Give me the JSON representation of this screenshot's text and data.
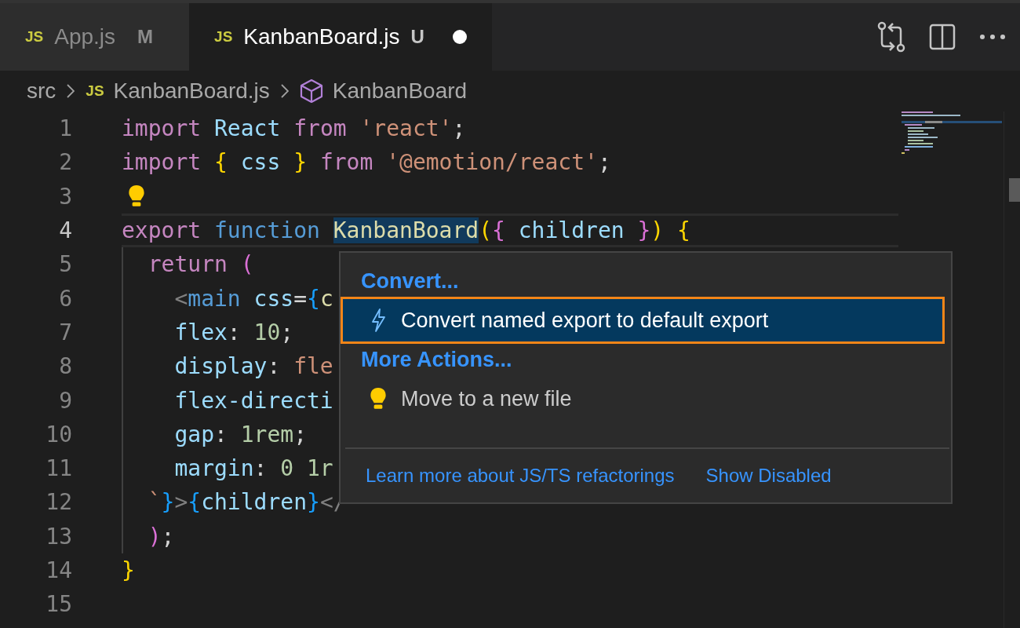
{
  "tabs": [
    {
      "icon": "JS",
      "label": "App.js",
      "status": "M",
      "selected": false,
      "dirty": false
    },
    {
      "icon": "JS",
      "label": "KanbanBoard.js",
      "status": "U",
      "selected": true,
      "dirty": true
    }
  ],
  "breadcrumb": [
    {
      "kind": "folder",
      "text": "src"
    },
    {
      "kind": "file",
      "icon": "JS",
      "text": "KanbanBoard.js"
    },
    {
      "kind": "symbol",
      "text": "KanbanBoard"
    }
  ],
  "code_lines": [
    {
      "number": "1",
      "current": false,
      "kind": "code",
      "tokens": [
        {
          "text": "import ",
          "kind": "keyword",
          "highlighted": false
        },
        {
          "text": "React ",
          "kind": "ident",
          "highlighted": false
        },
        {
          "text": "from ",
          "kind": "keyword",
          "highlighted": false
        },
        {
          "text": "'react'",
          "kind": "string",
          "highlighted": false
        },
        {
          "text": ";",
          "kind": "plain",
          "highlighted": false
        }
      ]
    },
    {
      "number": "2",
      "current": false,
      "kind": "code",
      "tokens": [
        {
          "text": "import ",
          "kind": "keyword",
          "highlighted": false
        },
        {
          "text": "{",
          "kind": "brace1",
          "highlighted": false
        },
        {
          "text": " css ",
          "kind": "ident",
          "highlighted": false
        },
        {
          "text": "} ",
          "kind": "brace1",
          "highlighted": false
        },
        {
          "text": "from ",
          "kind": "keyword",
          "highlighted": false
        },
        {
          "text": "'@emotion/react'",
          "kind": "string",
          "highlighted": false
        },
        {
          "text": ";",
          "kind": "plain",
          "highlighted": false
        }
      ]
    },
    {
      "number": "3",
      "current": false,
      "kind": "lightbulb"
    },
    {
      "number": "4",
      "current": true,
      "kind": "code",
      "tokens": [
        {
          "text": "export ",
          "kind": "keyword",
          "highlighted": false
        },
        {
          "text": "function ",
          "kind": "storage",
          "highlighted": false
        },
        {
          "text": "KanbanBoard",
          "kind": "function",
          "highlighted": true
        },
        {
          "text": "(",
          "kind": "brace1",
          "highlighted": false
        },
        {
          "text": "{",
          "kind": "brace2",
          "highlighted": false
        },
        {
          "text": " children ",
          "kind": "ident",
          "highlighted": false
        },
        {
          "text": "}",
          "kind": "brace2",
          "highlighted": false
        },
        {
          "text": ") ",
          "kind": "brace1",
          "highlighted": false
        },
        {
          "text": "{",
          "kind": "brace1",
          "highlighted": false
        }
      ]
    },
    {
      "number": "5",
      "current": false,
      "kind": "code",
      "tokens": [
        {
          "text": "  return ",
          "kind": "keyword",
          "highlighted": false
        },
        {
          "text": "(",
          "kind": "brace2",
          "highlighted": false
        }
      ]
    },
    {
      "number": "6",
      "current": false,
      "kind": "code",
      "tokens": [
        {
          "text": "    <",
          "kind": "punct",
          "highlighted": false
        },
        {
          "text": "main",
          "kind": "tag",
          "highlighted": false
        },
        {
          "text": " css",
          "kind": "ident",
          "highlighted": false
        },
        {
          "text": "=",
          "kind": "plain",
          "highlighted": false
        },
        {
          "text": "{",
          "kind": "brace3",
          "highlighted": false
        },
        {
          "text": "c",
          "kind": "function",
          "highlighted": false
        }
      ]
    },
    {
      "number": "7",
      "current": false,
      "kind": "code",
      "tokens": [
        {
          "text": "    flex",
          "kind": "ident",
          "highlighted": false
        },
        {
          "text": ": ",
          "kind": "plain",
          "highlighted": false
        },
        {
          "text": "10",
          "kind": "number",
          "highlighted": false
        },
        {
          "text": ";",
          "kind": "plain",
          "highlighted": false
        }
      ]
    },
    {
      "number": "8",
      "current": false,
      "kind": "code",
      "tokens": [
        {
          "text": "    display",
          "kind": "ident",
          "highlighted": false
        },
        {
          "text": ": ",
          "kind": "plain",
          "highlighted": false
        },
        {
          "text": "fle",
          "kind": "string",
          "highlighted": false
        }
      ]
    },
    {
      "number": "9",
      "current": false,
      "kind": "code",
      "tokens": [
        {
          "text": "    flex-directi",
          "kind": "ident",
          "highlighted": false
        }
      ]
    },
    {
      "number": "10",
      "current": false,
      "kind": "code",
      "tokens": [
        {
          "text": "    gap",
          "kind": "ident",
          "highlighted": false
        },
        {
          "text": ": ",
          "kind": "plain",
          "highlighted": false
        },
        {
          "text": "1rem",
          "kind": "number",
          "highlighted": false
        },
        {
          "text": ";",
          "kind": "plain",
          "highlighted": false
        }
      ]
    },
    {
      "number": "11",
      "current": false,
      "kind": "code",
      "tokens": [
        {
          "text": "    margin",
          "kind": "ident",
          "highlighted": false
        },
        {
          "text": ": ",
          "kind": "plain",
          "highlighted": false
        },
        {
          "text": "0 1r",
          "kind": "number",
          "highlighted": false
        }
      ]
    },
    {
      "number": "12",
      "current": false,
      "kind": "code",
      "tokens": [
        {
          "text": "  `",
          "kind": "string",
          "highlighted": false
        },
        {
          "text": "}",
          "kind": "brace3",
          "highlighted": false
        },
        {
          "text": ">",
          "kind": "punct",
          "highlighted": false
        },
        {
          "text": "{",
          "kind": "brace3",
          "highlighted": false
        },
        {
          "text": "children",
          "kind": "ident",
          "highlighted": false
        },
        {
          "text": "}",
          "kind": "brace3",
          "highlighted": false
        },
        {
          "text": "</",
          "kind": "punct",
          "highlighted": false
        }
      ]
    },
    {
      "number": "13",
      "current": false,
      "kind": "code",
      "tokens": [
        {
          "text": "  )",
          "kind": "brace2",
          "highlighted": false
        },
        {
          "text": ";",
          "kind": "plain",
          "highlighted": false
        }
      ]
    },
    {
      "number": "14",
      "current": false,
      "kind": "code",
      "tokens": [
        {
          "text": "}",
          "kind": "brace1",
          "highlighted": false
        }
      ]
    },
    {
      "number": "15",
      "current": false,
      "kind": "code"
    }
  ],
  "code_actions": {
    "sections": [
      {
        "title": "Convert...",
        "items": [
          {
            "kind": "refactor",
            "label": "Convert named export to default export",
            "selected": true
          }
        ]
      },
      {
        "title": "More Actions...",
        "items": [
          {
            "kind": "quickfix",
            "label": "Move to a new file",
            "selected": false
          }
        ]
      }
    ],
    "footer_links": [
      "Learn more about JS/TS refactorings",
      "Show Disabled"
    ]
  }
}
